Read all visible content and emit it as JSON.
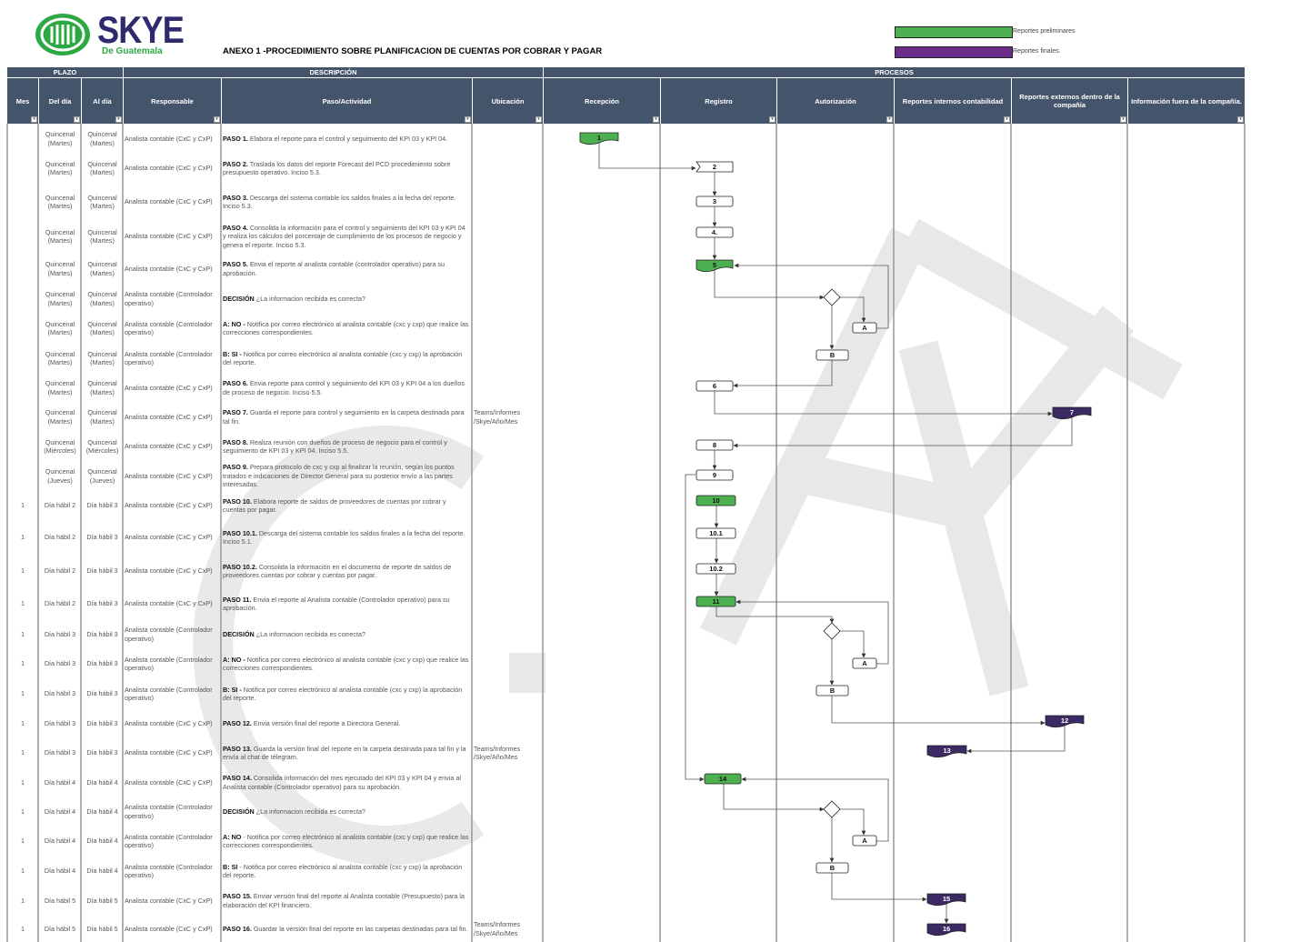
{
  "header": {
    "brand": "SKYE",
    "brand_sub": "De Guatemala",
    "title": "ANEXO 1 -PROCEDIMIENTO SOBRE PLANIFICACION DE CUENTAS POR COBRAR Y PAGAR",
    "legend": [
      {
        "label": "Reportes preliminares",
        "color": "#4caf50"
      },
      {
        "label": "Reportes finales.",
        "color": "#6a2d8c"
      }
    ]
  },
  "groups": {
    "plazo": "PLAZO",
    "descripcion": "DESCRIPCIÓN",
    "procesos": "PROCESOS"
  },
  "columns": {
    "mes": "Mes",
    "del_dia": "Del día",
    "al_dia": "Al día",
    "responsable": "Responsable",
    "paso": "Paso/Actividad",
    "ubicacion": "Ubicación",
    "recepcion": "Recepción",
    "registro": "Registro",
    "autorizacion": "Autorización",
    "rep_internos": "Reportes internos contabilidad",
    "rep_externos": "Reportes externos dentro de la compañía",
    "info_fuera": "Información fuera de la compañía."
  },
  "rows": [
    {
      "mes": "",
      "del": "Quincenal (Martes)",
      "al": "Quincenal (Martes)",
      "resp": "Analista contable (CxC y CxP)",
      "key": "PASO 1.",
      "text": " Elabora el reporte para el control y seguimiento del KPI 03 y KPI 04.",
      "ubic": ""
    },
    {
      "mes": "",
      "del": "Quincenal (Martes)",
      "al": "Quincenal (Martes)",
      "resp": "Analista contable (CxC y CxP)",
      "key": "PASO 2.",
      "text": " Traslada los datos del reporte Forecast del PCD procedimiento sobre presupuesto operativo. Inciso 5.3.",
      "ubic": ""
    },
    {
      "mes": "",
      "del": "Quincenal (Martes)",
      "al": "Quincenal (Martes)",
      "resp": "Analista contable (CxC y CxP)",
      "key": "PASO 3.",
      "text": " Descarga del sistema contable los saldos finales a la fecha del reporte. Inciso 5.3.",
      "ubic": ""
    },
    {
      "mes": "",
      "del": "Quincenal (Martes)",
      "al": "Quincenal (Martes)",
      "resp": "Analista contable (CxC y CxP)",
      "key": "PASO 4.",
      "text": " Consolida la información para el control y seguimiento del KPI 03 y KPI 04 y realiza los cálculos del porcentaje de cumplimiento de los procesos de negocio y genera el reporte. Inciso 5.3.",
      "ubic": ""
    },
    {
      "mes": "",
      "del": "Quincenal (Martes)",
      "al": "Quincenal (Martes)",
      "resp": "Analista contable (CxC y CxP)",
      "key": "PASO 5.",
      "text": " Envia el reporte al analista contable (controlador operativo) para su aprobación.",
      "ubic": ""
    },
    {
      "mes": "",
      "del": "Quincenal (Martes)",
      "al": "Quincenal (Martes)",
      "resp": "Analista contable (Controlador operativo)",
      "key": "DECISIÓN",
      "text": " ¿La informacion recibida es correcta?",
      "ubic": ""
    },
    {
      "mes": "",
      "del": "Quincenal (Martes)",
      "al": "Quincenal (Martes)",
      "resp": "Analista contable (Controlador operativo)",
      "key": "A: NO -",
      "text": " Notifica por correo electrónico al analista contable (cxc y cxp) que realice las correcciones correspondientes.",
      "ubic": ""
    },
    {
      "mes": "",
      "del": "Quincenal (Martes)",
      "al": "Quincenal (Martes)",
      "resp": "Analista contable (Controlador operativo)",
      "key": "B: SI -",
      "text": " Notifica por correo electrónico al analista contable (cxc y cxp) la aprobación del reporte.",
      "ubic": ""
    },
    {
      "mes": "",
      "del": "Quincenal (Martes)",
      "al": "Quincenal (Martes)",
      "resp": "Analista contable (CxC y CxP)",
      "key": "PASO 6.",
      "text": " Envia reporte para control y seguimiento del KPI 03 y KPI 04 a los dueños de proceso de negocio. Inciso 5.5.",
      "ubic": ""
    },
    {
      "mes": "",
      "del": "Quincenal (Martes)",
      "al": "Quincenal (Martes)",
      "resp": "Analista contable (CxC y CxP)",
      "key": "PASO 7.",
      "text": " Guarda el reporte para control y seguimiento en la carpeta destinada para tal fin.",
      "ubic": "Teams/Informes /Skye/Año/Mes"
    },
    {
      "mes": "",
      "del": "Quincenal (Miércoles)",
      "al": "Quincenal (Miércoles)",
      "resp": "Analista contable (CxC y CxP)",
      "key": "PASO 8.",
      "text": " Realiza reunión con dueños de proceso de negocio para el control y seguimiento de KPI 03 y KPI 04. Inciso 5.5.",
      "ubic": ""
    },
    {
      "mes": "",
      "del": "Quincenal (Jueves)",
      "al": "Quincenal (Jueves)",
      "resp": "Analista contable (CxC y CxP)",
      "key": "PASO 9.",
      "text": " Prepara protocolo de cxc y cxp al finalizar la reunión, según los puntos tratados e indicaciones de Director General para su posterior envío a las partes interesadas.",
      "ubic": ""
    },
    {
      "mes": "1",
      "del": "Día hábil 2",
      "al": "Día hábil 3",
      "resp": "Analista contable (CxC y CxP)",
      "key": "PASO 10.",
      "text": " Elabora reporte de saldos de proveedores de cuentas por cobrar y cuentas por pagar.",
      "ubic": ""
    },
    {
      "mes": "1",
      "del": "Día hábil 2",
      "al": "Día hábil 3",
      "resp": "Analista contable (CxC y CxP)",
      "key": "PASO 10.1.",
      "text": " Descarga del sistema contable los saldos finales a la fecha del reporte. Inciso 5.1.",
      "ubic": ""
    },
    {
      "mes": "1",
      "del": "Día hábil 2",
      "al": "Día hábil 3",
      "resp": "Analista contable (CxC y CxP)",
      "key": "PASO 10.2.",
      "text": " Consolida la información en el documento de reporte de saldos de proveedores cuentas por cobrar y cuentas por pagar.",
      "ubic": ""
    },
    {
      "mes": "1",
      "del": "Día hábil 2",
      "al": "Día hábil 3",
      "resp": "Analista contable (CxC y CxP)",
      "key": "PASO 11.",
      "text": " Envia el reporte al Analista contable (Controlador operativo) para su aprobación.",
      "ubic": ""
    },
    {
      "mes": "1",
      "del": "Día hábil 3",
      "al": "Día hábil 3",
      "resp": "Analista contable (Controlador operativo)",
      "key": "DECISIÓN",
      "text": " ¿La informacion recibida es correcta?",
      "ubic": ""
    },
    {
      "mes": "1",
      "del": "Día hábil 3",
      "al": "Día hábil 3",
      "resp": "Analista contable (Controlador operativo)",
      "key": "A: NO -",
      "text": " Notifica por correo electrónico al analista contable (cxc y cxp) que realice las correcciones correspondientes.",
      "ubic": ""
    },
    {
      "mes": "1",
      "del": "Día hábil 3",
      "al": "Día hábil 3",
      "resp": "Analista contable (Controlador operativo)",
      "key": "B: SI -",
      "text": " Notifica por correo electrónico al analista contable (cxc y cxp) la aprobación del reporte.",
      "ubic": ""
    },
    {
      "mes": "1",
      "del": "Día hábil 3",
      "al": "Día hábil 3",
      "resp": "Analista contable (CxC y CxP)",
      "key": "PASO 12.",
      "text": " Envia versión final del reporte a Directora General.",
      "ubic": ""
    },
    {
      "mes": "1",
      "del": "Día hábil 3",
      "al": "Día hábil 3",
      "resp": "Analista contable (CxC y CxP)",
      "key": "PASO 13.",
      "text": " Guarda la versión final del reporte en la carpeta destinada para tal fin y la envía al chat de télegram.",
      "ubic": "Teams/Informes /Skye/Año/Mes"
    },
    {
      "mes": "1",
      "del": "Día hábil 4",
      "al": "Día hábil 4",
      "resp": "Analista contable (CxC y CxP)",
      "key": "PASO 14.",
      "text": " Consolida información del mes ejecutado del KPI 03 y KPI 04 y envia al Analista contable (Controlador operativo) para su aprobación.",
      "ubic": ""
    },
    {
      "mes": "1",
      "del": "Día hábil 4",
      "al": "Día hábil 4",
      "resp": "Analista contable (Controlador operativo)",
      "key": "DECISIÓN",
      "text": " ¿La informacion recibida es correcta?",
      "ubic": ""
    },
    {
      "mes": "1",
      "del": "Día hábil 4",
      "al": "Día hábil 4",
      "resp": "Analista contable (Controlador operativo)",
      "key": "A: NO",
      "text": " - Notifica por correo electrónico al analista contable (cxc y cxp) que realice las correcciones correspondientes.",
      "ubic": ""
    },
    {
      "mes": "1",
      "del": "Día hábil 4",
      "al": "Día hábil 4",
      "resp": "Analista contable (Controlador operativo)",
      "key": "B: SI",
      "text": " - Notifica por correo electrónico al analista contable (cxc y cxp) la aprobación del reporte.",
      "ubic": ""
    },
    {
      "mes": "1",
      "del": "Día hábil 5",
      "al": "Día hábil 5",
      "resp": "Analista contable (CxC y CxP)",
      "key": "PASO 15.",
      "text": " Enviar versión final del reporte al Analista contable (Presupuesto) para la elaboración del KPI financiero.",
      "ubic": ""
    },
    {
      "mes": "1",
      "del": "Día hábil 5",
      "al": "Día hábil 5",
      "resp": "Analista contable (CxC y CxP)",
      "key": "PASO 16.",
      "text": " Guardar la versión final del reporte en las carpetas destinadas para tal fin.",
      "ubic": "Teams/Informes /Skye/Año/Mes"
    }
  ],
  "flow": {
    "nodes": [
      {
        "id": "1",
        "label": "1",
        "kind": "green"
      },
      {
        "id": "2",
        "label": "2",
        "kind": "white"
      },
      {
        "id": "3",
        "label": "3",
        "kind": "white"
      },
      {
        "id": "4",
        "label": "4.",
        "kind": "white"
      },
      {
        "id": "5",
        "label": "5",
        "kind": "green"
      },
      {
        "id": "A1",
        "label": "A",
        "kind": "white"
      },
      {
        "id": "B1",
        "label": "B",
        "kind": "white"
      },
      {
        "id": "6",
        "label": "6",
        "kind": "white"
      },
      {
        "id": "7",
        "label": "7",
        "kind": "purple"
      },
      {
        "id": "8",
        "label": "8",
        "kind": "white"
      },
      {
        "id": "9",
        "label": "9",
        "kind": "white"
      },
      {
        "id": "10",
        "label": "10",
        "kind": "green"
      },
      {
        "id": "10.1",
        "label": "10.1",
        "kind": "white"
      },
      {
        "id": "10.2",
        "label": "10.2",
        "kind": "white"
      },
      {
        "id": "11",
        "label": "11",
        "kind": "green"
      },
      {
        "id": "A2",
        "label": "A",
        "kind": "white"
      },
      {
        "id": "B2",
        "label": "B",
        "kind": "white"
      },
      {
        "id": "12",
        "label": "12",
        "kind": "purple"
      },
      {
        "id": "13",
        "label": "13",
        "kind": "purple"
      },
      {
        "id": "14",
        "label": "14",
        "kind": "green"
      },
      {
        "id": "A3",
        "label": "A",
        "kind": "white"
      },
      {
        "id": "B3",
        "label": "B",
        "kind": "white"
      },
      {
        "id": "15",
        "label": "15",
        "kind": "purple"
      },
      {
        "id": "16",
        "label": "16",
        "kind": "purple"
      }
    ]
  },
  "colors": {
    "header": "#44546a",
    "green": "#4caf50",
    "purple": "#3b2a63",
    "logo_green": "#2ea843",
    "logo_navy": "#2e2a6e"
  }
}
